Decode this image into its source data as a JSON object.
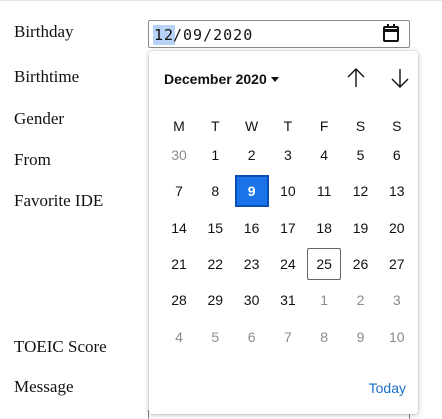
{
  "form": {
    "labels": {
      "birthday": "Birthday",
      "birthtime": "Birthtime",
      "gender": "Gender",
      "from": "From",
      "favorite_ide": "Favorite IDE",
      "toeic": "TOEIC Score",
      "message": "Message"
    },
    "birthday_value": {
      "month": "12",
      "rest": "/09/2020"
    }
  },
  "calendar": {
    "month_label": "December 2020",
    "weekdays": [
      "M",
      "T",
      "W",
      "T",
      "F",
      "S",
      "S"
    ],
    "weeks": [
      [
        "30",
        "1",
        "2",
        "3",
        "4",
        "5",
        "6"
      ],
      [
        "7",
        "8",
        "9",
        "10",
        "11",
        "12",
        "13"
      ],
      [
        "14",
        "15",
        "16",
        "17",
        "18",
        "19",
        "20"
      ],
      [
        "21",
        "22",
        "23",
        "24",
        "25",
        "26",
        "27"
      ],
      [
        "28",
        "29",
        "30",
        "31",
        "1",
        "2",
        "3"
      ],
      [
        "4",
        "5",
        "6",
        "7",
        "8",
        "9",
        "10"
      ]
    ],
    "selected_day": "9",
    "today_day": "25",
    "today_label": "Today"
  },
  "colors": {
    "accent": "#1a73e8",
    "link": "#1a6fc8",
    "out_of_month": "#8b8b8b",
    "selection_highlight": "#b7d2f6"
  },
  "icons": {
    "calendar": "calendar-icon",
    "month_dropdown": "caret-down-icon",
    "prev": "arrow-up-icon",
    "next": "arrow-down-icon"
  }
}
